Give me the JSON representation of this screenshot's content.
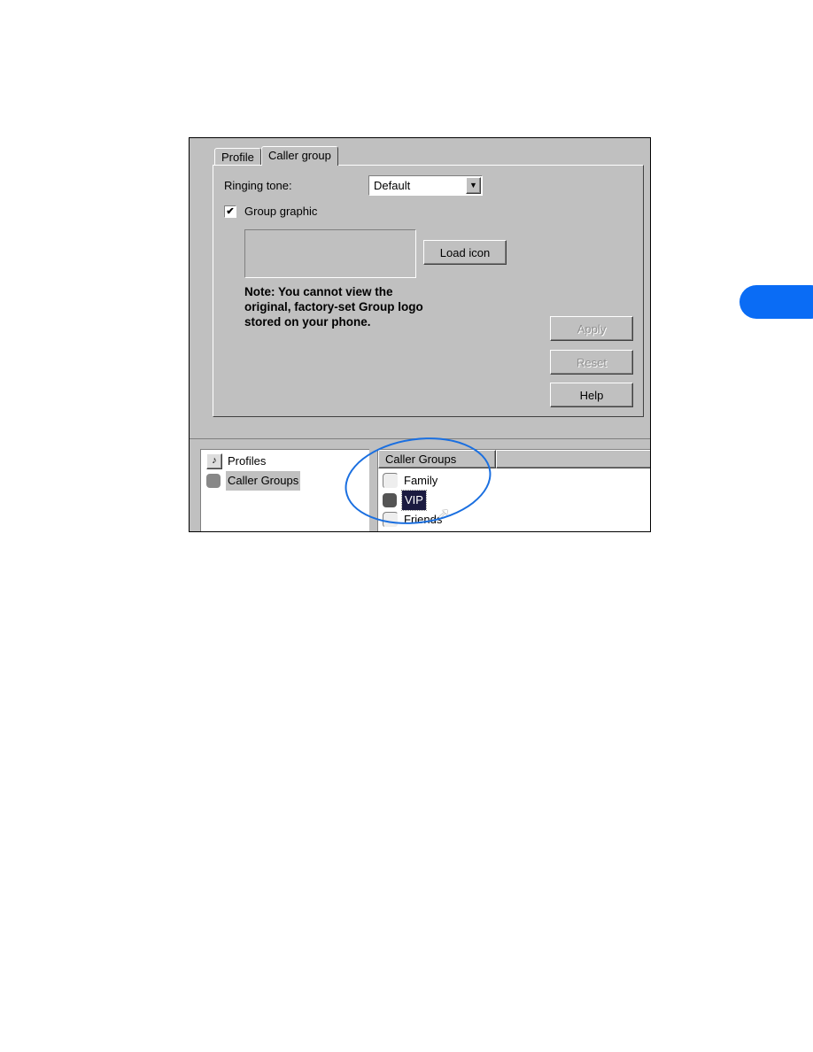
{
  "tabs": [
    {
      "label": "Profile",
      "active": false
    },
    {
      "label": "Caller group",
      "active": true
    }
  ],
  "ringing_tone": {
    "label": "Ringing tone:",
    "value": "Default"
  },
  "group_graphic": {
    "label": "Group graphic",
    "checked": true
  },
  "load_icon_label": "Load icon",
  "note": "Note: You cannot view the original, factory-set Group logo stored on your phone.",
  "buttons": {
    "apply": "Apply",
    "reset": "Reset",
    "help": "Help"
  },
  "tree": [
    {
      "label": "Profiles",
      "icon": "profile-icon"
    },
    {
      "label": "Caller Groups",
      "icon": "caller-groups-icon",
      "selected": true
    }
  ],
  "list": {
    "header": "Caller Groups",
    "items": [
      {
        "label": "Family"
      },
      {
        "label": "VIP",
        "selected": true
      },
      {
        "label": "Friends"
      }
    ]
  },
  "colors": {
    "highlight_ellipse": "#1a6fe0",
    "side_tab": "#0a6cf5"
  }
}
